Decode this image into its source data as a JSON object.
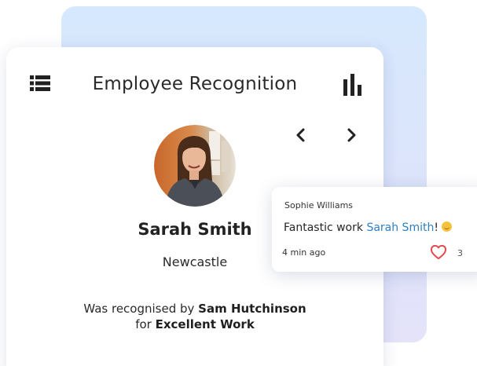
{
  "colors": {
    "accent_link": "#2f7fc1",
    "heart": "#e5484d",
    "panel_background": "#d6e8fd",
    "icon": "#222222"
  },
  "card": {
    "title": "Employee Recognition",
    "menu_icon": "list-icon",
    "stats_icon": "bar-chart-icon",
    "prev_icon": "chevron-left-icon",
    "next_icon": "chevron-right-icon"
  },
  "employee": {
    "name": "Sarah Smith",
    "location": "Newcastle"
  },
  "recognition": {
    "prefix": "Was recognised by ",
    "recognizer": "Sam Hutchinson",
    "for_prefix": "for ",
    "award": "Excellent Work"
  },
  "comment": {
    "author": "Sophie Williams",
    "text_prefix": "Fantastic work ",
    "mention": "Sarah Smith",
    "text_suffix": "!",
    "emoji": "smiling-face-emoji",
    "time": "4 min ago",
    "like_icon": "heart-icon",
    "likes": "3"
  }
}
